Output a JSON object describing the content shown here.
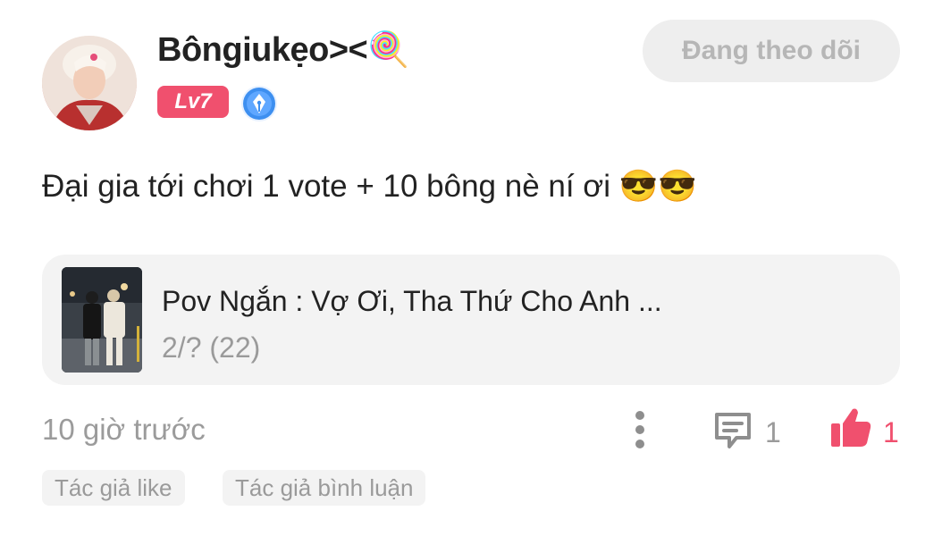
{
  "post": {
    "author": {
      "name": "Bôngiukẹo><",
      "name_emoji": "🍭",
      "level": "Lv7",
      "writer_badge": "pen-badge-icon"
    },
    "follow_button_label": "Đang theo dõi",
    "content": "Đại gia tới chơi 1 vote + 10 bông nè ní ơi",
    "content_emoji": "😎😎",
    "story": {
      "title": "Pov Ngắn : Vợ Ơi, Tha Thứ Cho Anh ...",
      "meta": "2/? (22)"
    },
    "timestamp": "10 giờ trước",
    "comment_count": "1",
    "like_count": "1",
    "tags": [
      "Tác giả like",
      "Tác giả bình luận"
    ]
  },
  "colors": {
    "accent_pink": "#f0506e",
    "muted_text": "#9b9b9b",
    "card_background": "#f3f3f3"
  }
}
